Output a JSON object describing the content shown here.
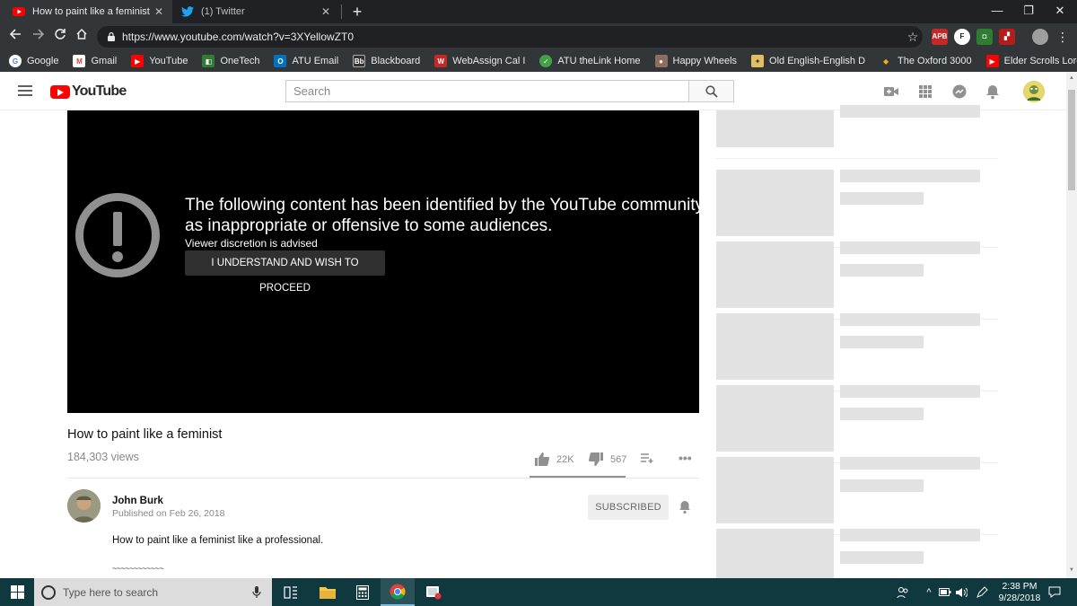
{
  "browser": {
    "tabs": [
      {
        "title": "How to paint like a feminist - You",
        "active": true
      },
      {
        "title": "(1) Twitter",
        "active": false
      }
    ],
    "tab_close": "✕",
    "new_tab": "+",
    "window_controls": {
      "minimize": "—",
      "restore": "❐",
      "close": "✕"
    },
    "url": "https://www.youtube.com/watch?v=3XYellowZT0",
    "star": "☆"
  },
  "bookmarks": [
    {
      "label": "Google",
      "icon": "google-icon",
      "color": "#ffffff"
    },
    {
      "label": "Gmail",
      "icon": "gmail-icon",
      "color": "#d44638"
    },
    {
      "label": "YouTube",
      "icon": "youtube-icon",
      "color": "#ff0000"
    },
    {
      "label": "OneTech",
      "icon": "onetech-icon",
      "color": "#2e7d32"
    },
    {
      "label": "ATU Email",
      "icon": "outlook-icon",
      "color": "#0072c6"
    },
    {
      "label": "Blackboard",
      "icon": "blackboard-icon",
      "color": "#333333"
    },
    {
      "label": "WebAssign Cal I",
      "icon": "webassign-icon",
      "color": "#c62828"
    },
    {
      "label": "ATU theLink Home",
      "icon": "thelink-icon",
      "color": "#43a047"
    },
    {
      "label": "Happy Wheels",
      "icon": "happywheels-icon",
      "color": "#8d6e63"
    },
    {
      "label": "Old English-English D",
      "icon": "dictionary-icon",
      "color": "#e0c060"
    },
    {
      "label": "The Oxford 3000",
      "icon": "oxford-icon",
      "color": "#f9a825"
    },
    {
      "label": "Elder Scrolls Lore: Ch",
      "icon": "youtube-icon",
      "color": "#ff0000"
    }
  ],
  "youtube": {
    "logo_text": "YouTube",
    "search_placeholder": "Search",
    "warning": {
      "heading_line1": "The following content has been identified by the YouTube community",
      "heading_line2": "as inappropriate or offensive to some audiences.",
      "sub": "Viewer discretion is advised",
      "button": "I UNDERSTAND AND WISH TO PROCEED"
    },
    "video": {
      "title": "How to paint like a feminist",
      "views": "184,303 views",
      "likes": "22K",
      "dislikes": "567",
      "like_ratio": 0.975
    },
    "channel": {
      "name": "John Burk",
      "published": "Published on Feb 26, 2018",
      "subscribe_label": "SUBSCRIBED"
    },
    "description": {
      "line1": "How to paint like a feminist like a professional.",
      "line2": "~~~~~~~~~~~~"
    }
  },
  "taskbar": {
    "search_placeholder": "Type here to search",
    "time": "2:38 PM",
    "date": "9/28/2018"
  },
  "colors": {
    "youtube_red": "#ff0000",
    "taskbar": "#10383f",
    "player_bg": "#000000",
    "skeleton": "#e2e2e2"
  }
}
